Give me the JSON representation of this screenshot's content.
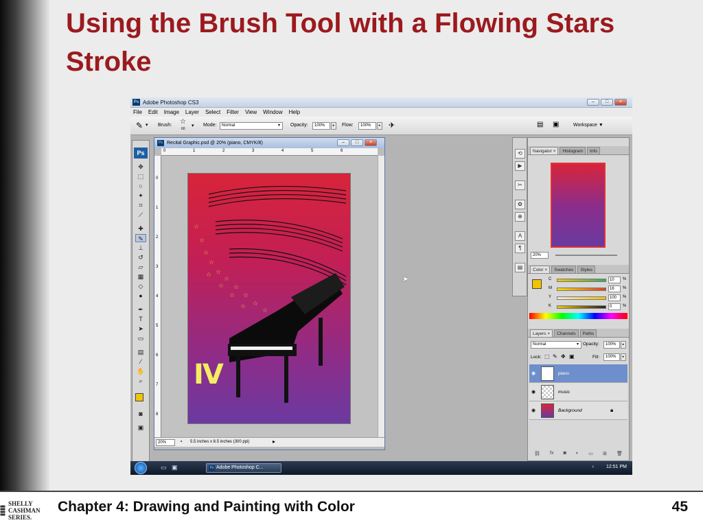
{
  "slide": {
    "title": "Using the Brush Tool with a Flowing Stars Stroke",
    "footer_title": "Chapter 4: Drawing and Painting with Color",
    "page_number": "45",
    "logo_text": "SHELLY CASHMAN SERIES."
  },
  "app": {
    "window_title": "Adobe Photoshop CS3",
    "badge": "Ps",
    "menus": [
      "File",
      "Edit",
      "Image",
      "Layer",
      "Select",
      "Filter",
      "View",
      "Window",
      "Help"
    ]
  },
  "options_bar": {
    "brush_label": "Brush:",
    "brush_size": "60",
    "mode_label": "Mode:",
    "mode_value": "Normal",
    "opacity_label": "Opacity:",
    "opacity_value": "100%",
    "flow_label": "Flow:",
    "flow_value": "100%",
    "workspace_label": "Workspace ▼"
  },
  "document": {
    "title": "Recital Graphic.psd @ 20% (piano, CMYK/8)",
    "zoom": "20%",
    "size_info": "5.5 inches x 8.5 inches (300 ppi)",
    "ruler_h": [
      "0",
      "1",
      "2",
      "3",
      "4",
      "5",
      "6"
    ],
    "ruler_v": [
      "0",
      "1",
      "2",
      "3",
      "4",
      "5",
      "6",
      "7",
      "8"
    ],
    "artwork_numeral": "IV"
  },
  "panels": {
    "nav_tabs": [
      "Navigator ×",
      "Histogram",
      "Info"
    ],
    "nav_zoom": "20%",
    "color_tabs": [
      "Color ×",
      "Swatches",
      "Styles"
    ],
    "color_rows": [
      {
        "label": "C",
        "value": "10",
        "unit": "%"
      },
      {
        "label": "M",
        "value": "16",
        "unit": "%"
      },
      {
        "label": "Y",
        "value": "100",
        "unit": "%"
      },
      {
        "label": "K",
        "value": "0",
        "unit": "%"
      }
    ],
    "layers_tabs": [
      "Layers ×",
      "Channels",
      "Paths"
    ],
    "blend_mode": "Normal",
    "layer_opacity_label": "Opacity:",
    "layer_opacity_value": "100%",
    "lock_label": "Lock:",
    "fill_label": "Fill:",
    "fill_value": "100%",
    "layers": [
      {
        "name": "piano",
        "selected": true
      },
      {
        "name": "music",
        "selected": false
      },
      {
        "name": "Background",
        "selected": false
      }
    ]
  },
  "taskbar": {
    "app_button": "Adobe Photoshop C...",
    "clock": "12:51 PM"
  },
  "colors": {
    "title_red": "#9b1a1e",
    "foreground_swatch": "#f2c400",
    "selected_layer": "#6d8fcb"
  }
}
